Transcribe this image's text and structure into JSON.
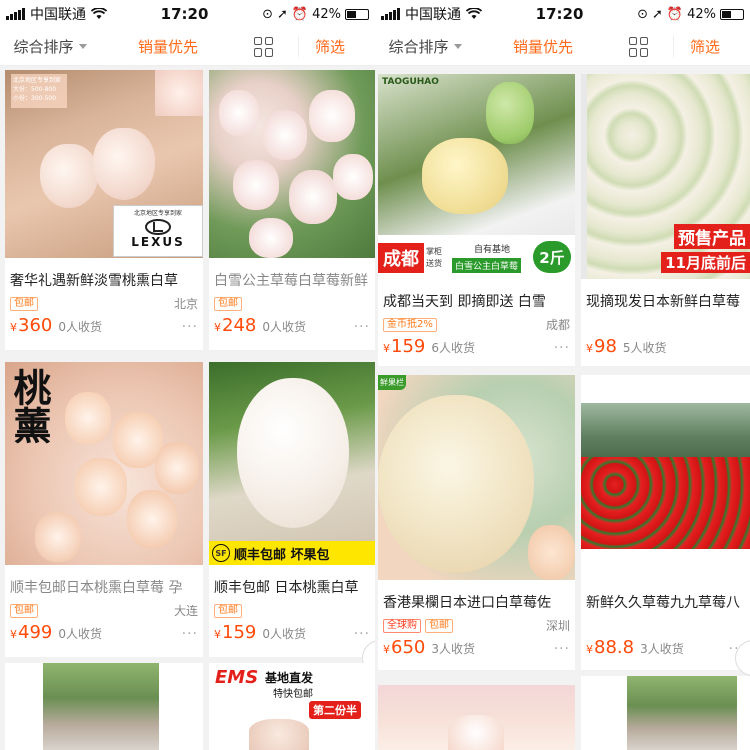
{
  "status": {
    "carrier": "中国联通",
    "time": "17:20",
    "battery": "42%",
    "battery_level": 0.42
  },
  "sortbar": {
    "default_label": "综合排序",
    "sales_label": "销量优先",
    "filter_label": "筛选"
  },
  "left": [
    {
      "title": "奢华礼遇新鲜淡雪桃熏白草",
      "tags": [
        "包邮"
      ],
      "location": "北京",
      "price": "360",
      "sold": "0人收货",
      "overlay": {
        "sign": "北京地区专享到家",
        "logo": "LEXUS",
        "top_text": "北京地区专享到家\n大份：500-800\n小份：300-500"
      }
    },
    {
      "title": "白雪公主草莓白草莓新鲜",
      "tags": [
        "包邮"
      ],
      "location": "",
      "price": "248",
      "sold": "0人收货"
    },
    {
      "title": "顺丰包邮日本桃熏白草莓 孕",
      "tags": [
        "包邮"
      ],
      "location": "大连",
      "price": "499",
      "sold": "0人收货",
      "overlay": {
        "calligraphy": "桃薰"
      }
    },
    {
      "title": "顺丰包邮 日本桃熏白草",
      "tags": [
        "包邮"
      ],
      "location": "",
      "price": "159",
      "sold": "0人收货",
      "overlay": {
        "banner": "顺丰包邮 坏果包",
        "sf": "SF"
      }
    }
  ],
  "left_bottom": {
    "ems": "EMS",
    "ems_text": "基地直发",
    "ems_sub": "特快包邮",
    "ems_badge": "第二份半"
  },
  "right": [
    {
      "title": "成都当天到 即摘即送 白雪",
      "tags": [
        "金币抵2%"
      ],
      "location": "成都",
      "price": "159",
      "sold": "6人收货",
      "overlay": {
        "brand": "TAOGUHAO",
        "city": "成都",
        "sub1": "掌柜",
        "sub2": "送货",
        "sub3": "自有基地",
        "product": "白雪公主白草莓",
        "weight": "2斤"
      }
    },
    {
      "title": "现摘现发日本新鲜白草莓",
      "tags": [],
      "location": "",
      "price": "98",
      "sold": "5人收货",
      "overlay": {
        "presale": "预售产品",
        "date": "11月底前后"
      }
    },
    {
      "title": "香港果欄日本进口白草莓佐",
      "tags": [
        "全球购",
        "包邮"
      ],
      "location": "深圳",
      "price": "650",
      "sold": "3人收货",
      "overlay": {
        "corner": "鲜果栏"
      }
    },
    {
      "title": "新鲜久久草莓九九草莓八",
      "tags": [],
      "location": "",
      "price": "88.8",
      "sold": "3人收货"
    }
  ],
  "colors": {
    "accent": "#ff6a1a",
    "price": "#ff4a0a",
    "background": "#f2f2f2"
  }
}
